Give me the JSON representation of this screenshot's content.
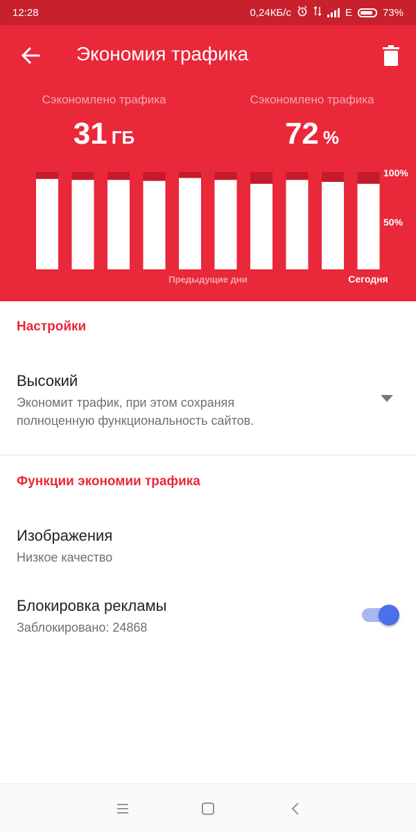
{
  "status_bar": {
    "time": "12:28",
    "speed": "0,24КБ/с",
    "network": "E",
    "battery": "73%",
    "icons": [
      "alarm-icon",
      "data-transfer-icon",
      "signal-icon",
      "battery-icon"
    ]
  },
  "header": {
    "title": "Экономия трафика",
    "back_icon": "arrow-left-icon",
    "delete_icon": "trash-icon"
  },
  "stats": {
    "left": {
      "label": "Сэкономлено трафика",
      "value": "31",
      "unit": "ГБ"
    },
    "right": {
      "label": "Сэкономлено трафика",
      "value": "72",
      "unit": "%"
    }
  },
  "chart_data": {
    "type": "bar",
    "categories": [
      "1",
      "2",
      "3",
      "4",
      "5",
      "6",
      "7",
      "8",
      "9",
      "10"
    ],
    "series": [
      {
        "values": [
          93,
          92,
          92,
          91,
          94,
          92,
          88,
          92,
          90,
          88
        ]
      }
    ],
    "ylim": [
      0,
      100
    ],
    "y_ticks": [
      "100%",
      "50%"
    ],
    "x_labels": {
      "previous": "Предыдущие дни",
      "today": "Сегодня"
    },
    "colors": {
      "saved": "#ffffff",
      "used": "#c41a2b"
    }
  },
  "settings": {
    "section_title": "Настройки",
    "mode_title": "Высокий",
    "mode_description_line1": "Экономит трафик, при этом сохраняя",
    "mode_description_line2": "полноценную функциональность сайтов."
  },
  "features": {
    "section_title": "Функции экономии трафика",
    "images_title": "Изображения",
    "images_value": "Низкое качество",
    "adblock_title": "Блокировка рекламы",
    "adblock_value": "Заблокировано: 24868",
    "adblock_enabled": true
  },
  "colors": {
    "accent": "#e9283a",
    "status_bar": "#c9202e",
    "toggle_on": "#4a70ea"
  },
  "nav_bar": {
    "icons": [
      "menu-icon",
      "home-square-icon",
      "back-chevron-icon"
    ]
  }
}
